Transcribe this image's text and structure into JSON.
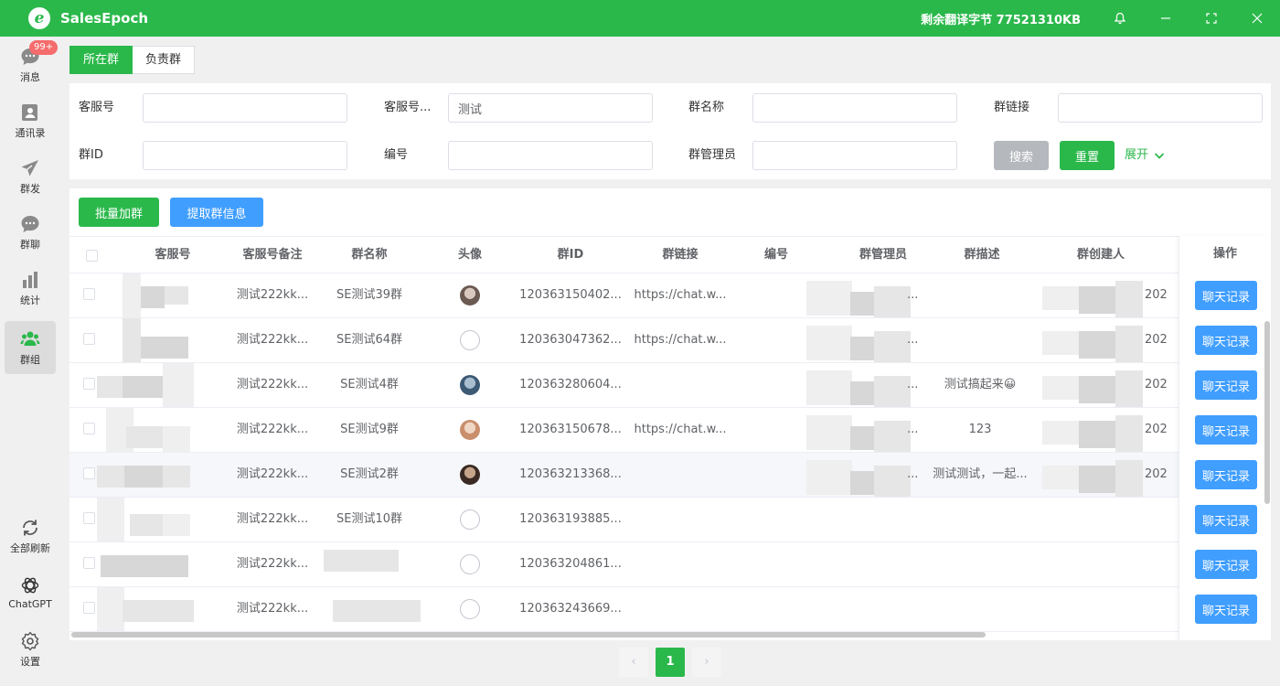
{
  "app": {
    "title": "SalesEpoch",
    "logo_letter": "e",
    "remaining_bytes": "剩余翻译字节 77521310KB"
  },
  "sidebar": {
    "badge": "99+",
    "items": [
      {
        "label": "消息",
        "icon": "message-icon"
      },
      {
        "label": "通讯录",
        "icon": "contacts-icon"
      },
      {
        "label": "群发",
        "icon": "send-icon"
      },
      {
        "label": "群聊",
        "icon": "group-chat-icon"
      },
      {
        "label": "统计",
        "icon": "stats-icon"
      },
      {
        "label": "群组",
        "icon": "groups-icon",
        "active": true
      }
    ],
    "bottom_items": [
      {
        "label": "全部刷新",
        "icon": "refresh-icon"
      },
      {
        "label": "ChatGPT",
        "icon": "chatgpt-icon"
      },
      {
        "label": "设置",
        "icon": "gear-icon"
      }
    ]
  },
  "tabs": [
    {
      "label": "所在群",
      "active": true
    },
    {
      "label": "负责群",
      "active": false
    }
  ],
  "filters": {
    "service_no": {
      "label": "客服号",
      "value": ""
    },
    "service_note": {
      "label": "客服号...",
      "value": "测试"
    },
    "group_name": {
      "label": "群名称",
      "value": ""
    },
    "group_link": {
      "label": "群链接",
      "value": ""
    },
    "group_id": {
      "label": "群ID",
      "value": ""
    },
    "number": {
      "label": "编号",
      "value": ""
    },
    "group_admin": {
      "label": "群管理员",
      "value": ""
    },
    "search_label": "搜索",
    "reset_label": "重置",
    "expand_label": "展开"
  },
  "actions": {
    "batch_join": "批量加群",
    "extract_info": "提取群信息"
  },
  "table": {
    "columns": [
      "客服号",
      "客服号备注",
      "群名称",
      "头像",
      "群ID",
      "群链接",
      "编号",
      "群管理员",
      "群描述",
      "群创建人",
      "操作"
    ],
    "rows": [
      {
        "note": "测试222kk...",
        "name": "SE测试39群",
        "id": "120363150402...",
        "link": "https://chat.w...",
        "admin": "...",
        "desc": "",
        "creator": "202",
        "avatar": "photo"
      },
      {
        "note": "测试222kk...",
        "name": "SE测试64群",
        "id": "120363047362...",
        "link": "https://chat.w...",
        "admin": "...",
        "desc": "",
        "creator": "202",
        "avatar": "broken"
      },
      {
        "note": "测试222kk...",
        "name": "SE测试4群",
        "id": "120363280604...",
        "link": "",
        "admin": "...",
        "desc": "测试搞起来😀",
        "creator": "202",
        "avatar": "photo"
      },
      {
        "note": "测试222kk...",
        "name": "SE测试9群",
        "id": "120363150678...",
        "link": "https://chat.w...",
        "admin": "...",
        "desc": "123",
        "creator": "202",
        "avatar": "photo"
      },
      {
        "note": "测试222kk...",
        "name": "SE测试2群",
        "id": "120363213368...",
        "link": "",
        "admin": "...",
        "desc": "测试测试，一起...",
        "creator": "202",
        "avatar": "photo"
      },
      {
        "note": "测试222kk...",
        "name": "SE测试10群",
        "id": "120363193885...",
        "link": "",
        "admin": "",
        "desc": "",
        "creator": "",
        "avatar": "broken"
      },
      {
        "note": "测试222kk...",
        "name": "",
        "id": "120363204861...",
        "link": "",
        "admin": "",
        "desc": "",
        "creator": "",
        "avatar": "broken"
      },
      {
        "note": "测试222kk...",
        "name": "",
        "id": "120363243669...",
        "link": "",
        "admin": "",
        "desc": "",
        "creator": "",
        "avatar": "broken"
      }
    ],
    "row_action": "聊天记录"
  },
  "pagination": {
    "current": "1",
    "prev": "‹",
    "next": "›"
  },
  "colors": {
    "brand": "#2bb84b",
    "primary": "#409eff",
    "badge": "#f56c6c"
  }
}
